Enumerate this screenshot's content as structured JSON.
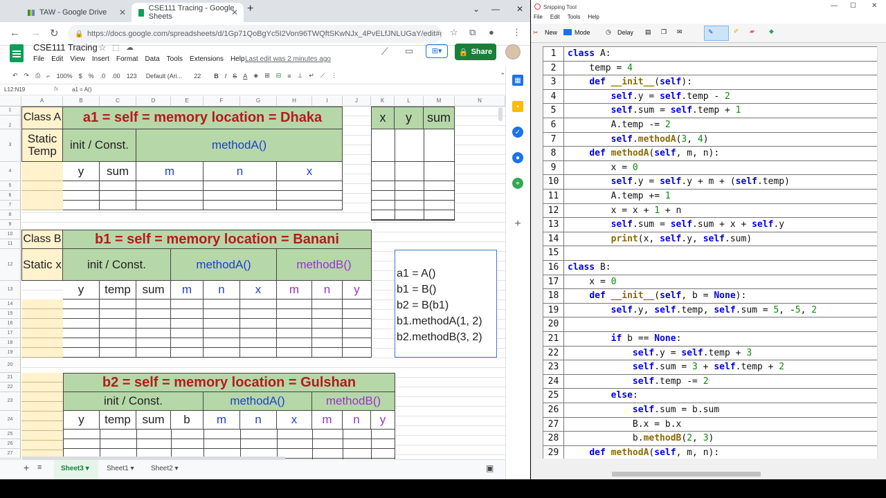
{
  "browser": {
    "tabs": [
      {
        "label": "TAW - Google Drive"
      },
      {
        "label": "CSE111 Tracing - Google Sheets"
      }
    ],
    "url": "https://docs.google.com/spreadsheets/d/1Gp71QoBgYc5I2Von96TWQftSKwNJx_4PvELfJNLUGaY/edit#gid=29..."
  },
  "sheets": {
    "doc_title": "CSE111 Tracing",
    "menu": [
      "File",
      "Edit",
      "View",
      "Insert",
      "Format",
      "Data",
      "Tools",
      "Extensions",
      "Help"
    ],
    "last_edit": "Last edit was 2 minutes ago",
    "share_label": "Share",
    "toolbar": {
      "zoom": "100%",
      "font": "Default (Ari...",
      "size": "22",
      "number_fmt": "123"
    },
    "cell_ref": "L12:N19",
    "formula": "a1 = A()",
    "columns": [
      "A",
      "B",
      "C",
      "D",
      "E",
      "F",
      "G",
      "H",
      "I",
      "J",
      "K",
      "L",
      "M",
      "N"
    ],
    "rows": [
      "1",
      "2",
      "3",
      "4",
      "5",
      "6",
      "7",
      "8",
      "9",
      "10",
      "11",
      "12",
      "13",
      "14",
      "15",
      "16",
      "17",
      "18",
      "19",
      "20",
      "21",
      "22",
      "23",
      "24",
      "25",
      "26",
      "27"
    ],
    "blockA": {
      "class_label": "Class A",
      "title": "a1 = self = memory location = Dhaka",
      "static_label": "Static Temp",
      "init": "init / Const.",
      "methodA": "methodA()",
      "cols": [
        "y",
        "sum",
        "m",
        "n",
        "x"
      ]
    },
    "xysum": [
      "x",
      "y",
      "sum"
    ],
    "blockB": {
      "class_label": "Class B",
      "title": "b1 = self = memory location = Banani",
      "static_label": "Static x",
      "init": "init / Const.",
      "methodA": "methodA()",
      "methodB": "methodB()",
      "cols": [
        "y",
        "temp",
        "sum",
        "m",
        "n",
        "x",
        "m",
        "n",
        "y"
      ]
    },
    "blockB2": {
      "title": "b2 = self = memory location = Gulshan",
      "init": "init / Const.",
      "methodA": "methodA()",
      "methodB": "methodB()",
      "cols": [
        "y",
        "temp",
        "sum",
        "b",
        "m",
        "n",
        "x",
        "m",
        "n",
        "y"
      ]
    },
    "note_lines": [
      "a1 = A()",
      "b1 = B()",
      "b2 = B(b1)",
      "b1.methodA(1, 2)",
      "b2.methodB(3, 2)"
    ],
    "sheet_tabs": [
      "Sheet3",
      "Sheet1",
      "Sheet2"
    ]
  },
  "snipping": {
    "title": "Snipping Tool",
    "menu": [
      "File",
      "Edit",
      "Tools",
      "Help"
    ],
    "toolbar": {
      "new": "New",
      "mode": "Mode",
      "delay": "Delay"
    },
    "code": [
      {
        "n": "1",
        "t": "class A:"
      },
      {
        "n": "2",
        "t": "    temp = 4"
      },
      {
        "n": "3",
        "t": "    def __init__(self):"
      },
      {
        "n": "4",
        "t": "        self.y = self.temp - 2"
      },
      {
        "n": "5",
        "t": "        self.sum = self.temp + 1"
      },
      {
        "n": "6",
        "t": "        A.temp -= 2"
      },
      {
        "n": "7",
        "t": "        self.methodA(3, 4)"
      },
      {
        "n": "8",
        "t": "    def methodA(self, m, n):"
      },
      {
        "n": "9",
        "t": "        x = 0"
      },
      {
        "n": "10",
        "t": "        self.y = self.y + m + (self.temp)"
      },
      {
        "n": "11",
        "t": "        A.temp += 1"
      },
      {
        "n": "12",
        "t": "        x = x + 1 + n"
      },
      {
        "n": "13",
        "t": "        self.sum = self.sum + x + self.y"
      },
      {
        "n": "14",
        "t": "        print(x, self.y, self.sum)"
      },
      {
        "n": "15",
        "t": ""
      },
      {
        "n": "16",
        "t": "class B:"
      },
      {
        "n": "17",
        "t": "    x = 0"
      },
      {
        "n": "18",
        "t": "    def __init__(self, b = None):"
      },
      {
        "n": "19",
        "t": "        self.y, self.temp, self.sum = 5, -5, 2"
      },
      {
        "n": "20",
        "t": ""
      },
      {
        "n": "21",
        "t": "        if b == None:"
      },
      {
        "n": "22",
        "t": "            self.y = self.temp + 3"
      },
      {
        "n": "23",
        "t": "            self.sum = 3 + self.temp + 2"
      },
      {
        "n": "24",
        "t": "            self.temp -= 2"
      },
      {
        "n": "25",
        "t": "        else:"
      },
      {
        "n": "26",
        "t": "            self.sum = b.sum"
      },
      {
        "n": "27",
        "t": "            B.x = b.x"
      },
      {
        "n": "28",
        "t": "            b.methodB(2, 3)"
      },
      {
        "n": "29",
        "t": "    def methodA(self, m, n):"
      }
    ]
  }
}
